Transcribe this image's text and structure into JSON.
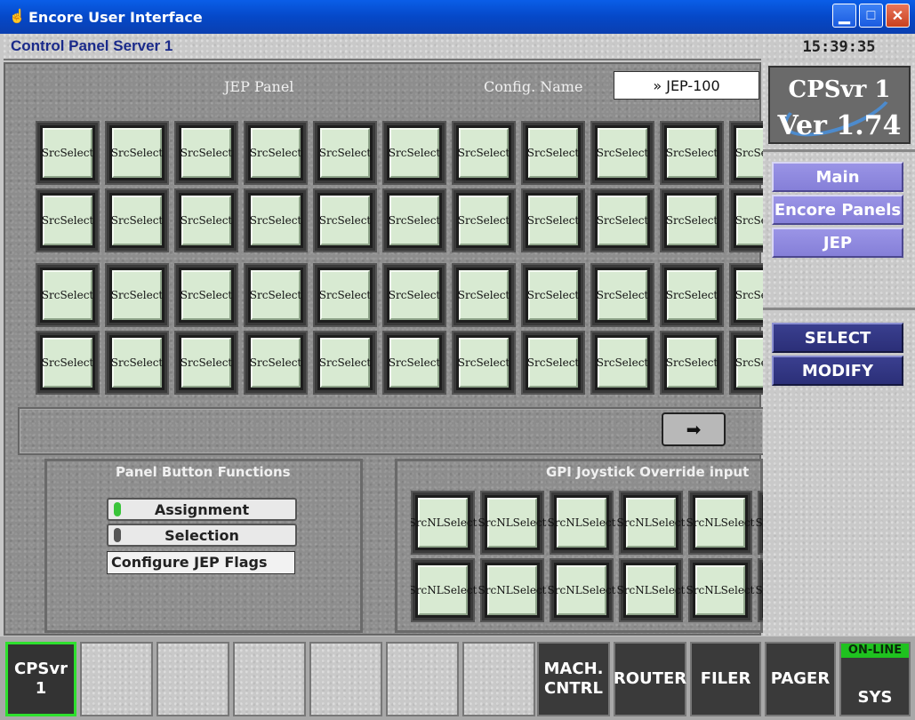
{
  "window": {
    "title": "Encore User Interface",
    "controls": [
      "minimize",
      "maximize",
      "close"
    ]
  },
  "header": {
    "title": "Control Panel Server 1",
    "clock": "15:39:35"
  },
  "jep_panel": {
    "label": "JEP Panel",
    "config_label": "Config. Name",
    "config_value": "» JEP-100",
    "button_label_line1": "Src",
    "button_label_line2": "Select",
    "rows": 4,
    "cols_visible": 11,
    "scroll_arrow": "➡"
  },
  "panel_button_functions": {
    "title": "Panel Button Functions",
    "options": [
      {
        "label": "Assignment",
        "led_color": "#39c439"
      },
      {
        "label": "Selection",
        "led_color": "#555555"
      }
    ],
    "configure_label": "Configure JEP Flags"
  },
  "gpi": {
    "title": "GPI Joystick Override input",
    "button_label_line1": "SrcNL",
    "button_label_line2": "Select",
    "rows": 2,
    "cols_visible": 6
  },
  "sidebar": {
    "logo_line1": "CPSvr 1",
    "logo_line2": "Ver 1.74",
    "nav": [
      "Main",
      "Encore Panels",
      "JEP"
    ],
    "actions": [
      "SELECT",
      "MODIFY"
    ]
  },
  "bottom_bar": {
    "cpsvr_line1": "CPSvr",
    "cpsvr_line2": "1",
    "mach_line1": "MACH.",
    "mach_line2": "CNTRL",
    "router": "ROUTER",
    "filer": "FILER",
    "pager": "PAGER",
    "sys": "SYS",
    "online": "ON-LINE"
  }
}
